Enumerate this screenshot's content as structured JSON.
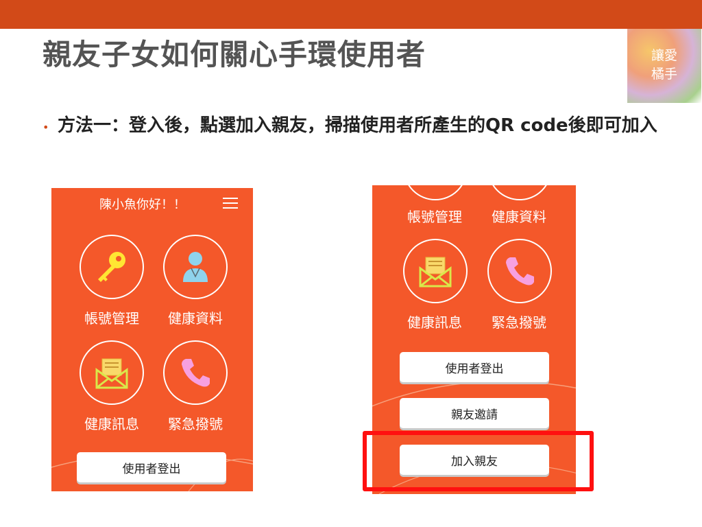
{
  "slide": {
    "title": "親友子女如何關心手環使用者",
    "logo_text": "讓愛\n橘手",
    "bullet": "方法一：登入後，點選加入親友，掃描使用者所產生的QR code後即可加入"
  },
  "phone1": {
    "greeting": "陳小魚你好！！",
    "tiles": [
      {
        "label": "帳號管理",
        "icon": "key-icon"
      },
      {
        "label": "健康資料",
        "icon": "person-icon"
      },
      {
        "label": "健康訊息",
        "icon": "envelope-icon"
      },
      {
        "label": "緊急撥號",
        "icon": "phone-icon"
      }
    ],
    "logout_button": "使用者登出"
  },
  "phone2": {
    "tiles": [
      {
        "label": "帳號管理"
      },
      {
        "label": "健康資料"
      },
      {
        "label": "健康訊息",
        "icon": "envelope-icon"
      },
      {
        "label": "緊急撥號",
        "icon": "phone-icon"
      }
    ],
    "buttons": [
      "使用者登出",
      "親友邀請",
      "加入親友"
    ]
  },
  "colors": {
    "header_bar": "#d24a18",
    "app_background": "#f4582a",
    "highlight": "#ff1010"
  }
}
